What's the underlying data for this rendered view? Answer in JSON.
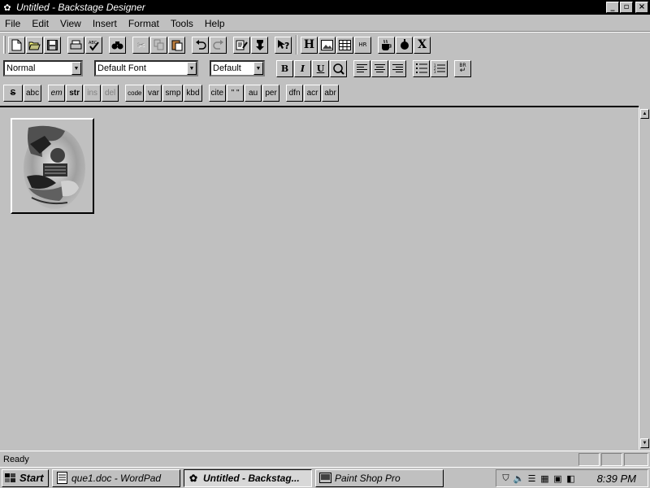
{
  "window": {
    "title": "Untitled - Backstage Designer",
    "controls": {
      "minimize": "_",
      "maximize": "▫",
      "close": "×"
    }
  },
  "menu": [
    "File",
    "Edit",
    "View",
    "Insert",
    "Format",
    "Tools",
    "Help"
  ],
  "toolbar1": {
    "icons": [
      "new-document-icon",
      "open-folder-icon",
      "save-disk-icon",
      "print-icon",
      "spell-check-icon",
      "find-binoculars-icon",
      "cut-icon",
      "copy-icon",
      "paste-icon",
      "undo-icon",
      "redo-icon",
      "edit-icon",
      "pin-icon",
      "help-pointer-icon",
      "heading-icon",
      "image-icon",
      "table-icon",
      "horizontal-rule-icon",
      "java-cup-icon",
      "script-icon",
      "close-x-icon"
    ],
    "labels": {
      "heading": "H",
      "hr": "HR",
      "close": "X",
      "help": "?"
    }
  },
  "format_toolbar": {
    "style": "Normal",
    "font": "Default Font",
    "size": "Default",
    "bold": "B",
    "italic": "I",
    "underline": "U",
    "break": "BR"
  },
  "tag_toolbar": {
    "buttons": [
      {
        "label": "S",
        "disabled": false
      },
      {
        "label": "abc",
        "disabled": false
      },
      {
        "label": "em",
        "disabled": false
      },
      {
        "label": "str",
        "disabled": false
      },
      {
        "label": "ins",
        "disabled": true
      },
      {
        "label": "del",
        "disabled": true
      },
      {
        "label": "code",
        "disabled": false
      },
      {
        "label": "var",
        "disabled": false
      },
      {
        "label": "smp",
        "disabled": false
      },
      {
        "label": "kbd",
        "disabled": false
      },
      {
        "label": "cite",
        "disabled": false
      },
      {
        "label": "\" \"",
        "disabled": false
      },
      {
        "label": "au",
        "disabled": false
      },
      {
        "label": "per",
        "disabled": false
      },
      {
        "label": "dfn",
        "disabled": false
      },
      {
        "label": "acr",
        "disabled": false
      },
      {
        "label": "abr",
        "disabled": false
      }
    ]
  },
  "status": {
    "text": "Ready"
  },
  "taskbar": {
    "start": "Start",
    "tasks": [
      {
        "label": "que1.doc - WordPad",
        "active": false
      },
      {
        "label": "Untitled - Backstag...",
        "active": true
      },
      {
        "label": "Paint Shop Pro",
        "active": false
      }
    ],
    "clock": "8:39 PM"
  },
  "colors": {
    "face": "#c0c0c0",
    "titlebar": "#000000",
    "highlight": "#ffffff",
    "shadow": "#808080"
  }
}
